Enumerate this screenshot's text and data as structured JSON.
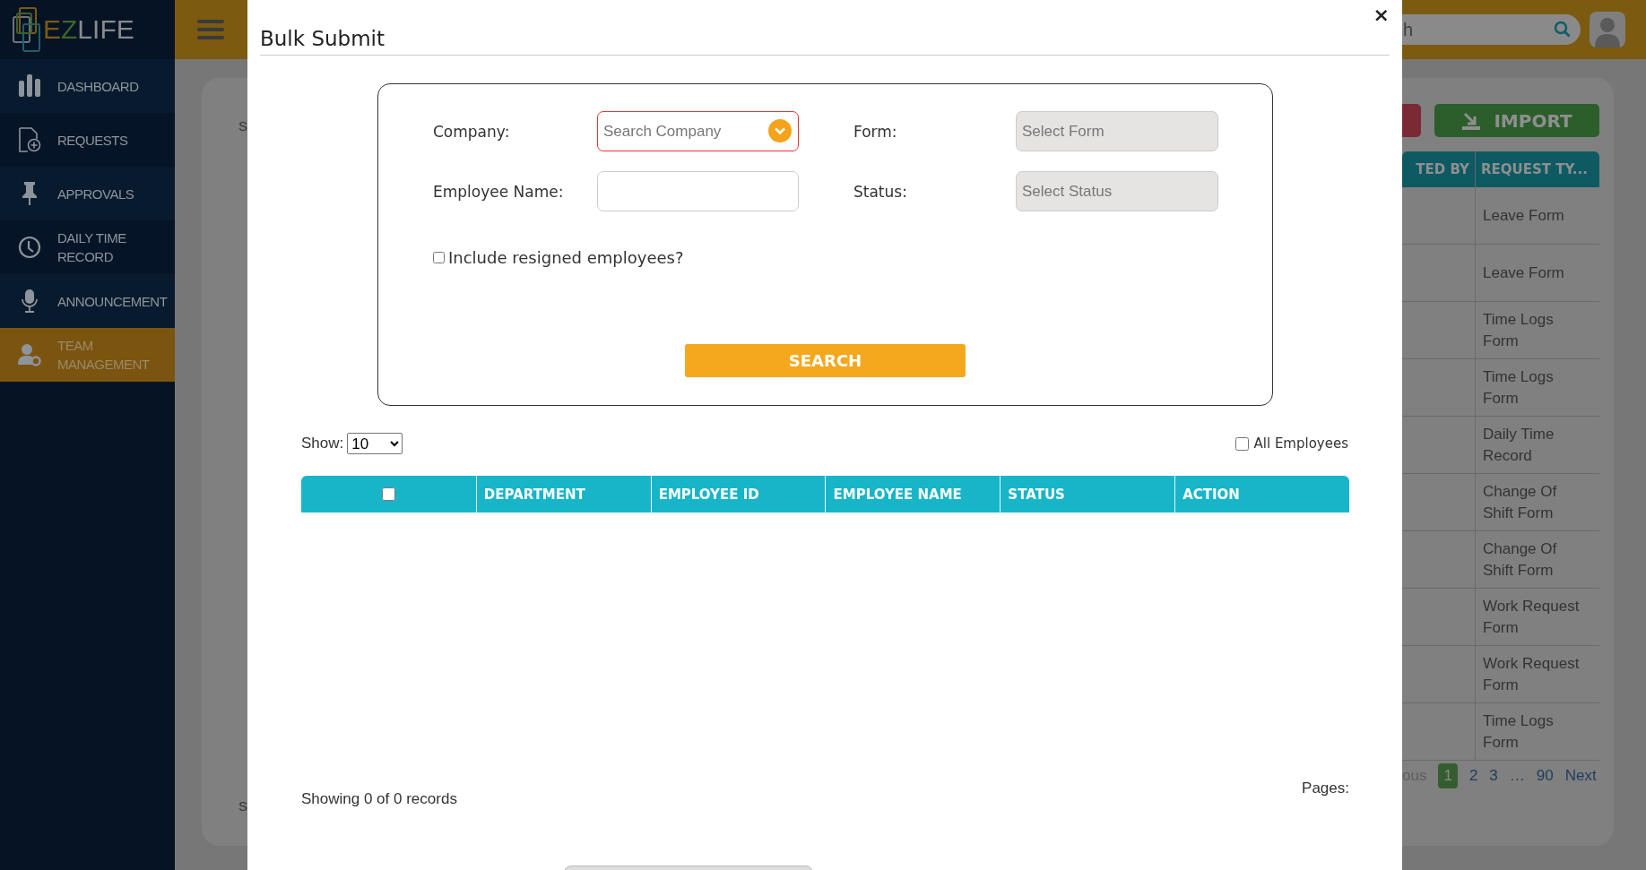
{
  "sidebar": {
    "logo": "EZLIFE",
    "items": [
      {
        "label": "DASHBOARD",
        "kind": "chart",
        "selected": false
      },
      {
        "label": "REQUESTS",
        "kind": "document",
        "selected": false
      },
      {
        "label": "APPROVALS",
        "kind": "pin",
        "selected": false
      },
      {
        "label": "DAILY TIME RECORD",
        "kind": "clock",
        "selected": false
      },
      {
        "label": "ANNOUNCEMENT",
        "kind": "microphone",
        "selected": false
      },
      {
        "label": "TEAM MANAGEMENT",
        "kind": "team",
        "selected": true
      }
    ]
  },
  "topbar": {
    "search_value": "h"
  },
  "page": {
    "cut_labels": [
      "S",
      "S"
    ],
    "import_button": "IMPORT",
    "table": {
      "columns": [
        "TED BY",
        "REQUEST TY..."
      ],
      "rows": [
        "Leave Form",
        "Leave Form",
        "Time Logs Form",
        "Time Logs Form",
        "Daily Time Record",
        "Change Of Shift Form",
        "Change Of Shift Form",
        "Work Request Form",
        "Work Request Form",
        "Time Logs Form"
      ]
    },
    "pagination": {
      "previous": "ous",
      "pages": [
        {
          "label": "1",
          "selected": true
        },
        {
          "label": "2",
          "selected": false
        },
        {
          "label": "3",
          "selected": false
        },
        {
          "label": "…",
          "selected": false
        },
        {
          "label": "90",
          "selected": false
        }
      ],
      "next": "Next"
    }
  },
  "modal": {
    "title": "Bulk Submit",
    "close": "×",
    "fields": [
      {
        "label": "Company:",
        "placeholder": "Search Company",
        "kind": "combo",
        "invalid": true,
        "disabled": false
      },
      {
        "label": "Form:",
        "placeholder": "Select Form",
        "kind": "select",
        "invalid": false,
        "disabled": true
      },
      {
        "label": "Employee Name:",
        "kind": "text",
        "invalid": false,
        "disabled": false
      },
      {
        "label": "Status:",
        "placeholder": "Select Status",
        "kind": "select",
        "invalid": false,
        "disabled": true
      }
    ],
    "include_resigned": {
      "label": "Include resigned employees?",
      "checked": false
    },
    "search_button": "SEARCH",
    "show": {
      "label": "Show:",
      "value": "10"
    },
    "all_employees": {
      "label": "All Employees",
      "checked": false
    },
    "table": {
      "select_all_checked": false,
      "columns": [
        "DEPARTMENT",
        "EMPLOYEE ID",
        "EMPLOYEE NAME",
        "STATUS",
        "ACTION"
      ]
    },
    "records": "Showing 0 of 0 records",
    "pages_label": "Pages:"
  }
}
